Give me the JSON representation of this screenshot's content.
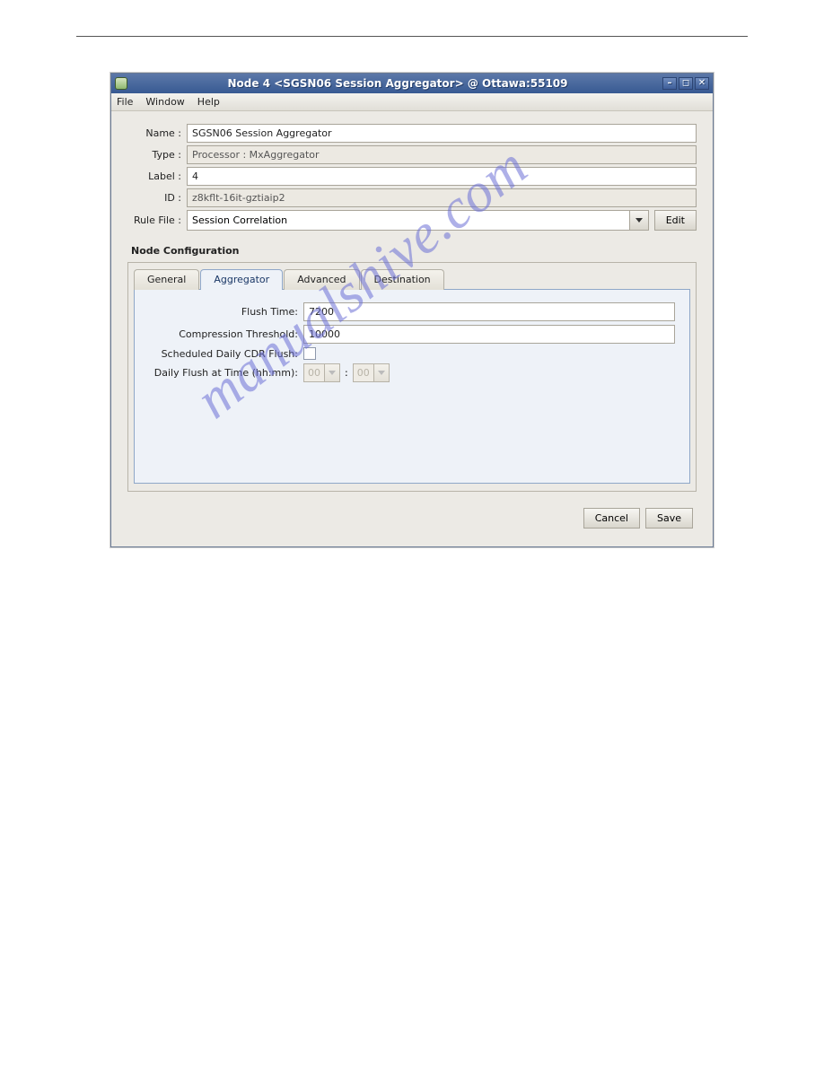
{
  "window": {
    "title": "Node 4 <SGSN06 Session Aggregator> @ Ottawa:55109"
  },
  "menu": {
    "file": "File",
    "window": "Window",
    "help": "Help"
  },
  "form": {
    "name_label": "Name :",
    "name_value": "SGSN06 Session Aggregator",
    "type_label": "Type :",
    "type_value": "Processor : MxAggregator",
    "label_label": "Label :",
    "label_value": "4",
    "id_label": "ID :",
    "id_value": "z8kflt-16it-gztiaip2",
    "rule_label": "Rule File :",
    "rule_value": "Session Correlation",
    "edit_btn": "Edit"
  },
  "section_title": "Node Configuration",
  "tabs": {
    "general": "General",
    "aggregator": "Aggregator",
    "advanced": "Advanced",
    "destination": "Destination"
  },
  "cfg": {
    "flush_time_label": "Flush Time:",
    "flush_time_value": "7200",
    "compression_label": "Compression Threshold:",
    "compression_value": "10000",
    "scheduled_label": "Scheduled Daily CDR Flush:",
    "daily_label": "Daily Flush at Time (hh:mm):",
    "hh": "00",
    "mm": "00",
    "colon": ":"
  },
  "buttons": {
    "cancel": "Cancel",
    "save": "Save"
  },
  "watermark": "manualshive.com"
}
